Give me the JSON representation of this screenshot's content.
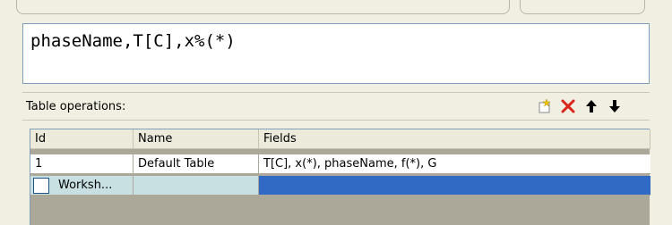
{
  "formula": {
    "value": "phaseName,T[C],x%(*)"
  },
  "ops_bar": {
    "label": "Table operations:",
    "buttons": [
      {
        "name": "new-table-icon"
      },
      {
        "name": "delete-icon",
        "color": "#d9261c"
      },
      {
        "name": "arrow-up-icon"
      },
      {
        "name": "arrow-down-icon"
      }
    ]
  },
  "table": {
    "columns": [
      "Id",
      "Name",
      "Fields"
    ],
    "rows": [
      {
        "id": "1",
        "name": "Default Table",
        "fields": "T[C], x(*), phaseName, f(*), G"
      }
    ],
    "new_row": {
      "label": "Worksh...",
      "checked": false
    }
  },
  "colors": {
    "window_bg": "#f1efe2",
    "selection": "#316ac5",
    "new_row_bg": "#c8e0e2",
    "table_bg": "#aca899"
  }
}
